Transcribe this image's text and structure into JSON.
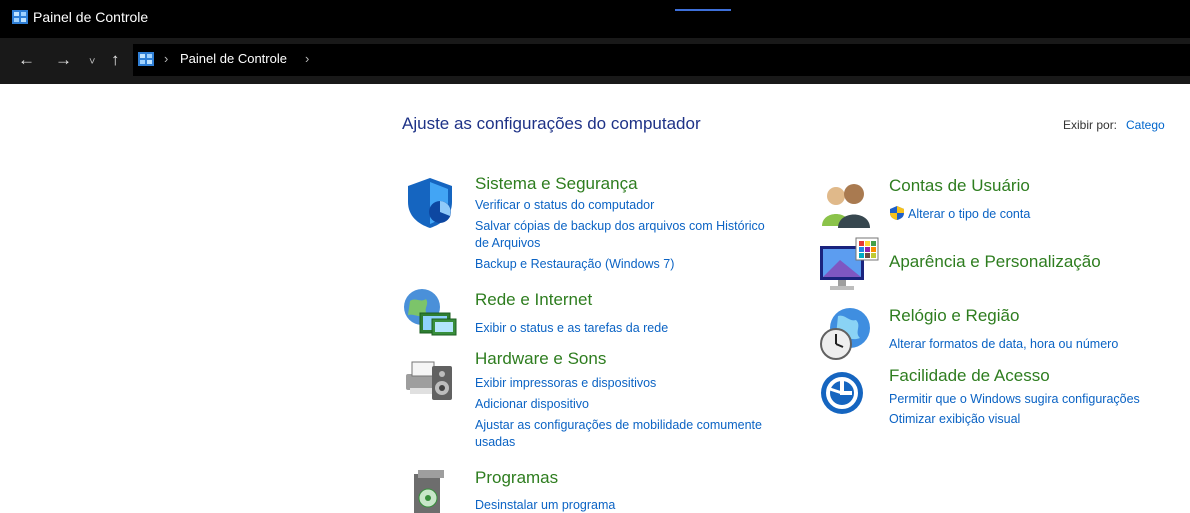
{
  "window": {
    "title": "Painel de Controle"
  },
  "nav": {
    "back": "←",
    "forward": "→",
    "recent": "˅",
    "up": "↑"
  },
  "breadcrumb": {
    "sep1": "›",
    "item": "Painel de Controle",
    "sep2": "›"
  },
  "header": {
    "title": "Ajuste as configurações do computador",
    "view_by_label": "Exibir por:",
    "view_by_value": "Catego"
  },
  "categories": {
    "system": {
      "title": "Sistema e Segurança",
      "links": [
        "Verificar o status do computador",
        "Salvar cópias de backup dos arquivos com Histórico",
        "de Arquivos",
        "Backup e Restauração (Windows 7)"
      ]
    },
    "network": {
      "title": "Rede e Internet",
      "links": [
        "Exibir o status e as tarefas da rede"
      ]
    },
    "hardware": {
      "title": "Hardware e Sons",
      "links": [
        "Exibir impressoras e dispositivos",
        "Adicionar dispositivo",
        "Ajustar as configurações de mobilidade comumente",
        "usadas"
      ]
    },
    "programs": {
      "title": "Programas",
      "links": [
        "Desinstalar um programa"
      ]
    },
    "accounts": {
      "title": "Contas de Usuário",
      "links": [
        "Alterar o tipo de conta"
      ]
    },
    "appearance": {
      "title": "Aparência e Personalização"
    },
    "clock": {
      "title": "Relógio e Região",
      "links": [
        "Alterar formatos de data, hora ou número"
      ]
    },
    "access": {
      "title": "Facilidade de Acesso",
      "links": [
        "Permitir que o Windows sugira configurações",
        "Otimizar exibição visual"
      ]
    }
  },
  "colors": {
    "title_blue": "#1e3287",
    "category_green": "#2e7d1f",
    "link_blue": "#0b63c4"
  }
}
